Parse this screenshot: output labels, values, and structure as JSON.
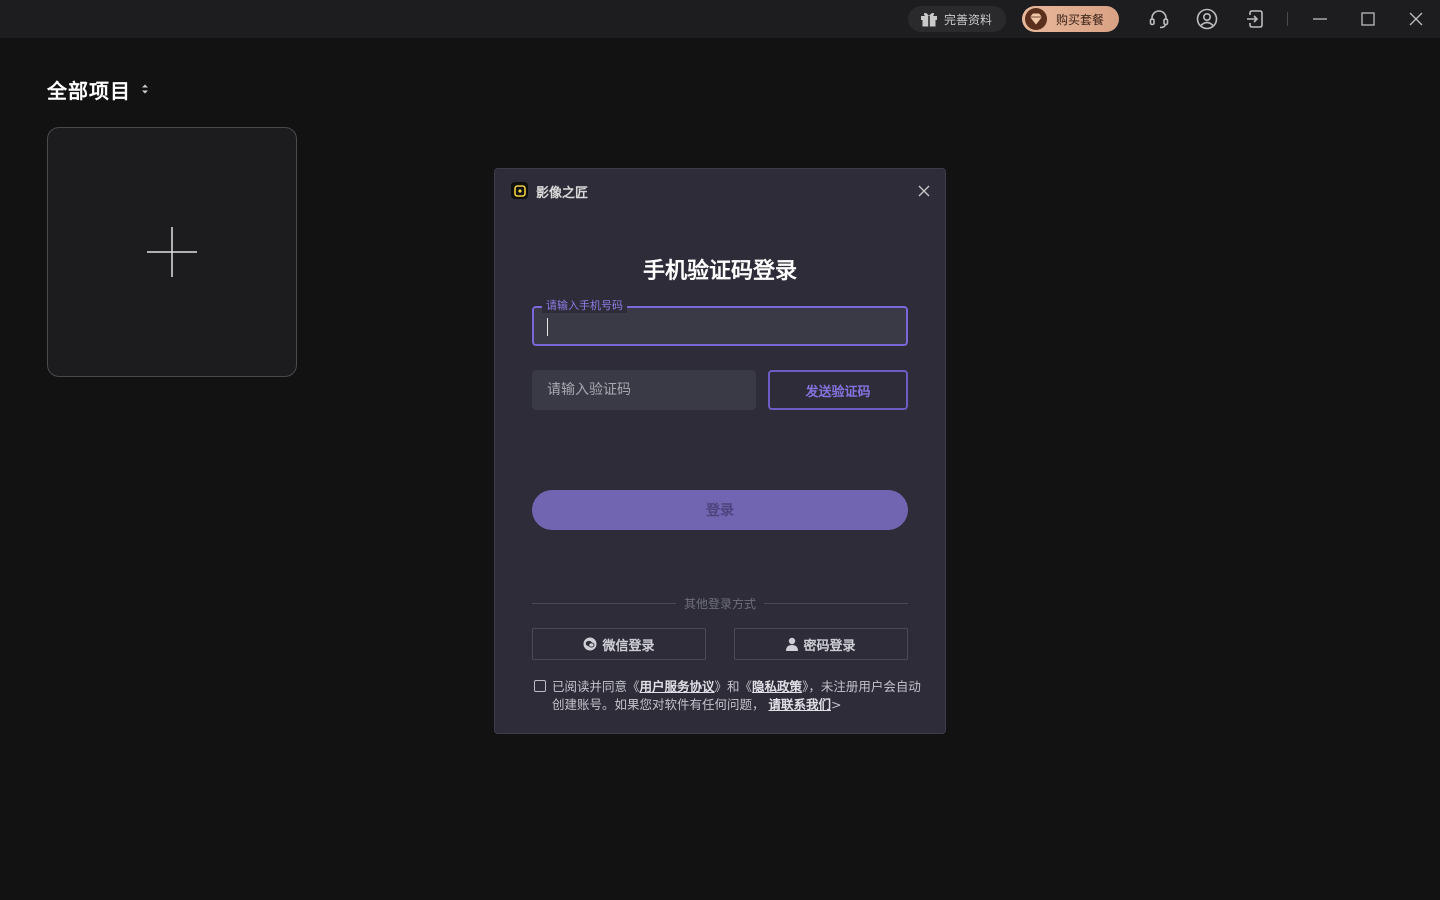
{
  "titlebar": {
    "profile_label": "完善资料",
    "buy_label": "购买套餐",
    "icons": [
      "gift-icon",
      "gem-icon",
      "support-headset-icon",
      "user-account-icon",
      "logout-icon",
      "minimize-icon",
      "maximize-icon",
      "close-icon"
    ]
  },
  "projects": {
    "title": "全部项目",
    "new_project_icon": "plus-icon"
  },
  "dialog": {
    "app_name": "影像之匠",
    "heading": "手机验证码登录",
    "phone_label": "请输入手机号码",
    "phone_value": "",
    "code_placeholder": "请输入验证码",
    "send_code_label": "发送验证码",
    "login_label": "登录",
    "other_methods": "其他登录方式",
    "wechat_label": "微信登录",
    "password_label": "密码登录",
    "agreement": {
      "prefix": "已阅读并同意《",
      "user_agreement": "用户服务协议",
      "and": "》和《",
      "privacy": "隐私政策",
      "middle": "》，未注册用户会自动创建账号。如果您对软件有任何问题，",
      "contact": "请联系我们",
      "suffix": ">"
    }
  },
  "colors": {
    "accent": "#7a68d6",
    "dialog_bg": "#2d2c38",
    "buy_pill": "#e8b89c",
    "page_bg": "#121212"
  }
}
